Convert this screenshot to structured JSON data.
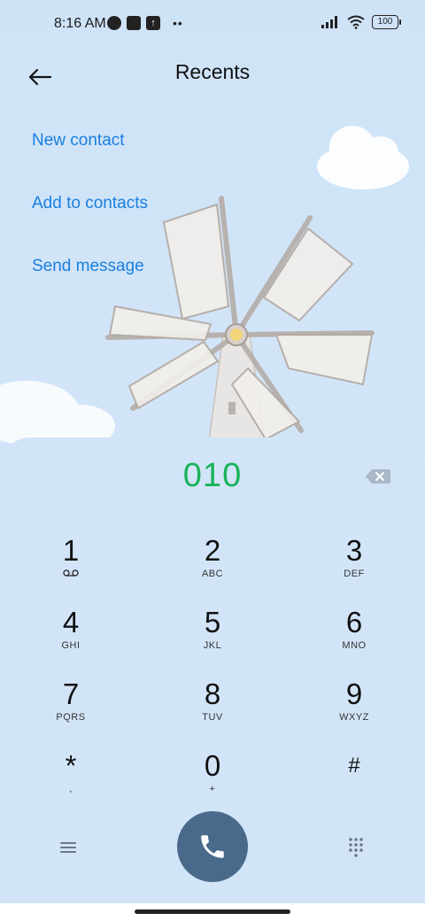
{
  "status_bar": {
    "time": "8:16 AM",
    "battery": "100",
    "icons": [
      "notification-app-icon",
      "square-icon",
      "upload-icon",
      "more-dots",
      "signal-icon",
      "wifi-icon",
      "battery-icon"
    ]
  },
  "header": {
    "title": "Recents",
    "back_icon": "arrow-left-icon"
  },
  "actions": {
    "new_contact": "New contact",
    "add_to_contacts": "Add to contacts",
    "send_message": "Send message"
  },
  "dialer": {
    "number": "010",
    "number_color": "#19b35a",
    "backspace_icon": "backspace-icon",
    "keys": [
      {
        "digit": "1",
        "letters": ""
      },
      {
        "digit": "2",
        "letters": "ABC"
      },
      {
        "digit": "3",
        "letters": "DEF"
      },
      {
        "digit": "4",
        "letters": "GHI"
      },
      {
        "digit": "5",
        "letters": "JKL"
      },
      {
        "digit": "6",
        "letters": "MNO"
      },
      {
        "digit": "7",
        "letters": "PQRS"
      },
      {
        "digit": "8",
        "letters": "TUV"
      },
      {
        "digit": "9",
        "letters": "WXYZ"
      },
      {
        "digit": "*",
        "letters": ","
      },
      {
        "digit": "0",
        "letters": "+"
      },
      {
        "digit": "#",
        "letters": ""
      }
    ],
    "call_button_color": "#4a6a8b",
    "accent_link_color": "#1a7fe0"
  }
}
